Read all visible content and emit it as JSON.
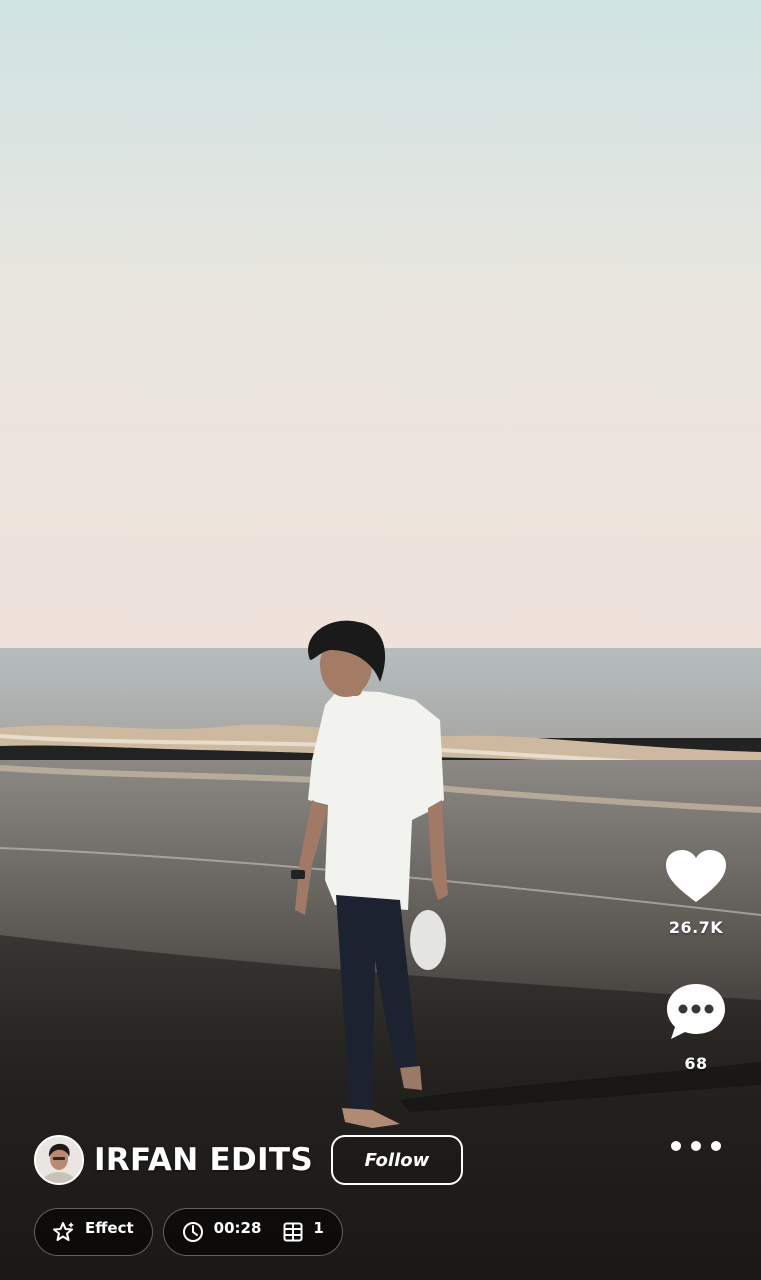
{
  "post": {
    "author_name": "IRFAN EDITS",
    "follow_label": "Follow",
    "likes": "26.7K",
    "comments": "68"
  },
  "meta": {
    "effect_label": "Effect",
    "duration": "00:28",
    "clips": "1"
  },
  "icons": {
    "like": "heart-icon",
    "comment": "speech-bubble-icon",
    "more": "more-dots-icon",
    "effect": "sparkle-icon",
    "duration": "clock-icon",
    "clips": "film-frame-icon"
  },
  "colors": {
    "sky_top": "#cfe3e3",
    "sky_bottom": "#efe3da",
    "sea": "#b7b8b4",
    "sand": "#3b3632",
    "pill_bg": "#121212",
    "text": "#ffffff"
  }
}
